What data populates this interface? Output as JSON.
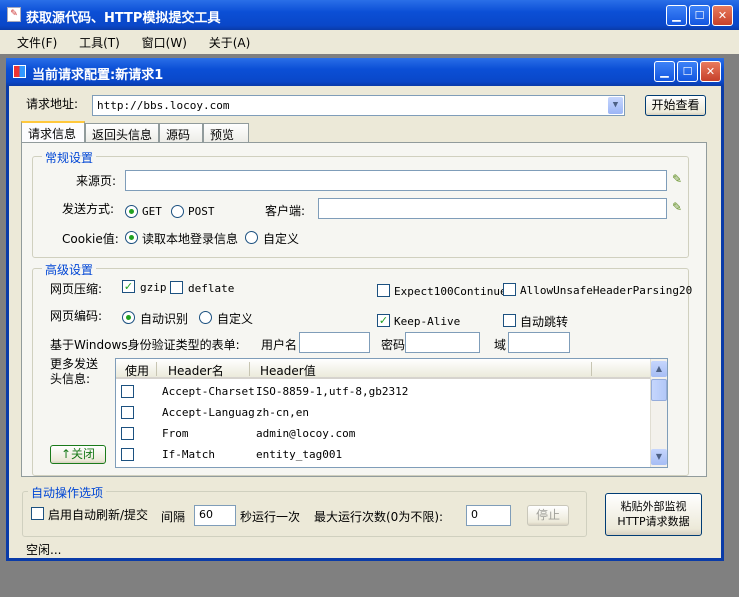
{
  "app": {
    "title": "获取源代码、HTTP模拟提交工具",
    "menu": [
      "文件(F)",
      "工具(T)",
      "窗口(W)",
      "关于(A)"
    ]
  },
  "child": {
    "title": "当前请求配置:新请求1"
  },
  "request": {
    "url_label": "请求地址:",
    "url": "http://bbs.locoy.com",
    "start_button": "开始查看"
  },
  "tabs": [
    "请求信息",
    "返回头信息",
    "源码",
    "预览"
  ],
  "general": {
    "legend": "常规设置",
    "referer_label": "来源页:",
    "referer": "",
    "method_label": "发送方式:",
    "method_get": "GET",
    "method_post": "POST",
    "client_label": "客户端:",
    "client": "",
    "cookie_label": "Cookie值:",
    "cookie_local": "读取本地登录信息",
    "cookie_custom": "自定义"
  },
  "advanced": {
    "legend": "高级设置",
    "compress_label": "网页压缩:",
    "gzip": "gzip",
    "deflate": "deflate",
    "expect100": "Expect100Continue",
    "unsafe_header": "AllowUnsafeHeaderParsing20",
    "encoding_label": "网页编码:",
    "enc_auto": "自动识别",
    "enc_custom": "自定义",
    "keep_alive": "Keep-Alive",
    "auto_redirect": "自动跳转",
    "windows_auth_label": "基于Windows身份验证类型的表单:",
    "username_label": "用户名",
    "password_label": "密码",
    "domain_label": "域",
    "more_headers_label": "更多发送\n头信息:",
    "close_button": "↑关闭",
    "headers_table": {
      "columns": [
        "使用",
        "Header名",
        "Header值"
      ],
      "rows": [
        {
          "name": "Accept-Charset",
          "value": "ISO-8859-1,utf-8,gb2312"
        },
        {
          "name": "Accept-Languag",
          "value": "zh-cn,en"
        },
        {
          "name": "From",
          "value": "admin@locoy.com"
        },
        {
          "name": "If-Match",
          "value": "entity_tag001"
        }
      ]
    }
  },
  "auto": {
    "legend": "自动操作选项",
    "enable_label": "启用自动刷新/提交",
    "interval_label": "间隔",
    "interval": "60",
    "seconds_label": "秒运行一次",
    "max_label": "最大运行次数(0为不限):",
    "max": "0",
    "stop_button": "停止",
    "paste_button": "粘贴外部监视\nHTTP请求数据"
  },
  "status": "空闲..."
}
